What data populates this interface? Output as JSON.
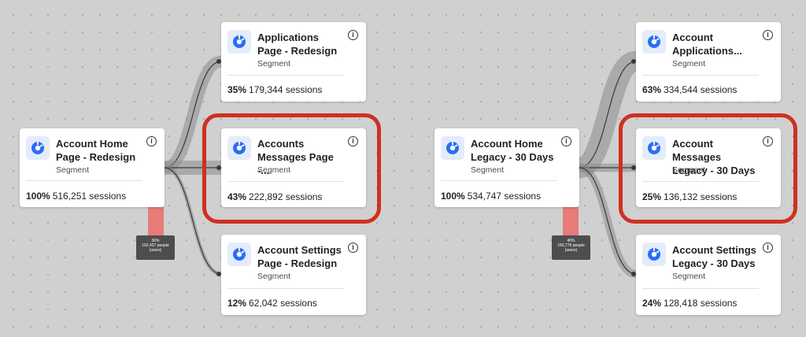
{
  "colors": {
    "highlight": "#d03020",
    "flow": "#8a8a8a",
    "dropoff": "#e87a78",
    "icon": "#2a6df4"
  },
  "diagrams": [
    {
      "root": {
        "title": "Account Home Page - Redesign",
        "subtitle": "Segment",
        "pct": "100%",
        "sessions": "516,251 sessions"
      },
      "branches": [
        {
          "title": "Applications Page - Redesign",
          "subtitle": "Segment",
          "pct": "35%",
          "sessions": "179,344 sessions",
          "highlighted": false
        },
        {
          "title": "Accounts Messages Page -...",
          "subtitle": "Segment",
          "pct": "43%",
          "sessions": "222,892 sessions",
          "highlighted": true
        },
        {
          "title": "Account Settings Page - Redesign",
          "subtitle": "Segment",
          "pct": "12%",
          "sessions": "62,042 sessions",
          "highlighted": false
        }
      ],
      "dropoff": {
        "pct": "36%",
        "people": "152,427 people",
        "unit": "(users)"
      }
    },
    {
      "root": {
        "title": "Account Home Legacy - 30 Days",
        "subtitle": "Segment",
        "pct": "100%",
        "sessions": "534,747 sessions"
      },
      "branches": [
        {
          "title": "Account Applications...",
          "subtitle": "Segment",
          "pct": "63%",
          "sessions": "334,544 sessions",
          "highlighted": false
        },
        {
          "title": "Account Messages Legacy - 30 Days",
          "subtitle": "Segment",
          "pct": "25%",
          "sessions": "136,132 sessions",
          "highlighted": true
        },
        {
          "title": "Account Settings Legacy - 30 Days",
          "subtitle": "Segment",
          "pct": "24%",
          "sessions": "128,418 sessions",
          "highlighted": false
        }
      ],
      "dropoff": {
        "pct": "40%",
        "people": "160,776 people",
        "unit": "(users)"
      }
    }
  ]
}
